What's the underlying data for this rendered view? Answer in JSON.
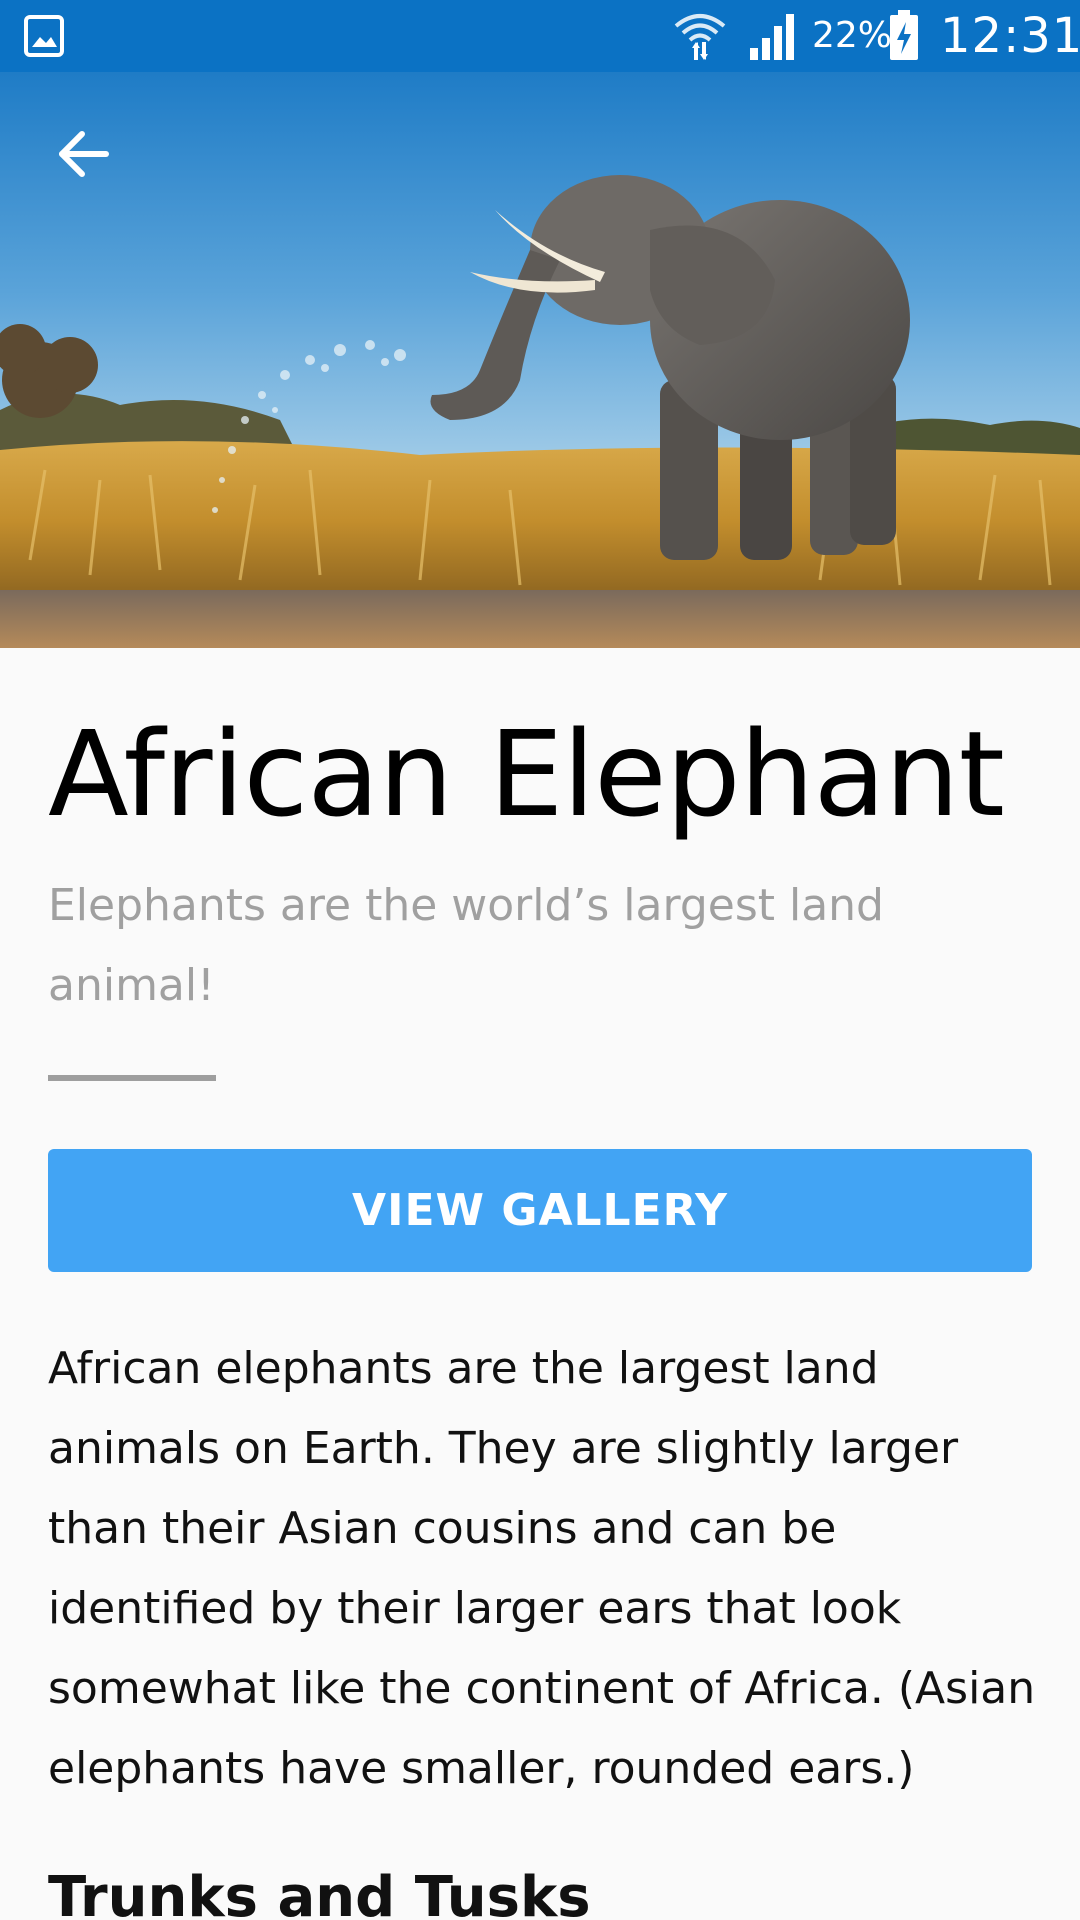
{
  "status_bar": {
    "battery_percent": "22%",
    "time": "12:31",
    "icons": [
      "gallery-notification-icon",
      "wifi-icon",
      "signal-icon",
      "battery-charging-icon"
    ]
  },
  "hero": {
    "icon": "elephant-photo",
    "back_icon": "arrow-left-icon"
  },
  "article": {
    "title": "African Elephant",
    "subtitle": "Elephants are the world’s largest land animal!",
    "gallery_button_label": "VIEW GALLERY",
    "body": "African elephants are the largest land animals on Earth. They are slightly larger than their Asian cousins and can be identified by their larger ears that look somewhat like the continent of Africa. (Asian elephants have smaller, rounded ears.)",
    "section_heading": "Trunks and Tusks"
  },
  "colors": {
    "status_bar": "#0b72c4",
    "button": "#42a4f4",
    "subtitle": "#a0a0a0",
    "divider": "#9e9e9e",
    "background": "#fafafa"
  }
}
